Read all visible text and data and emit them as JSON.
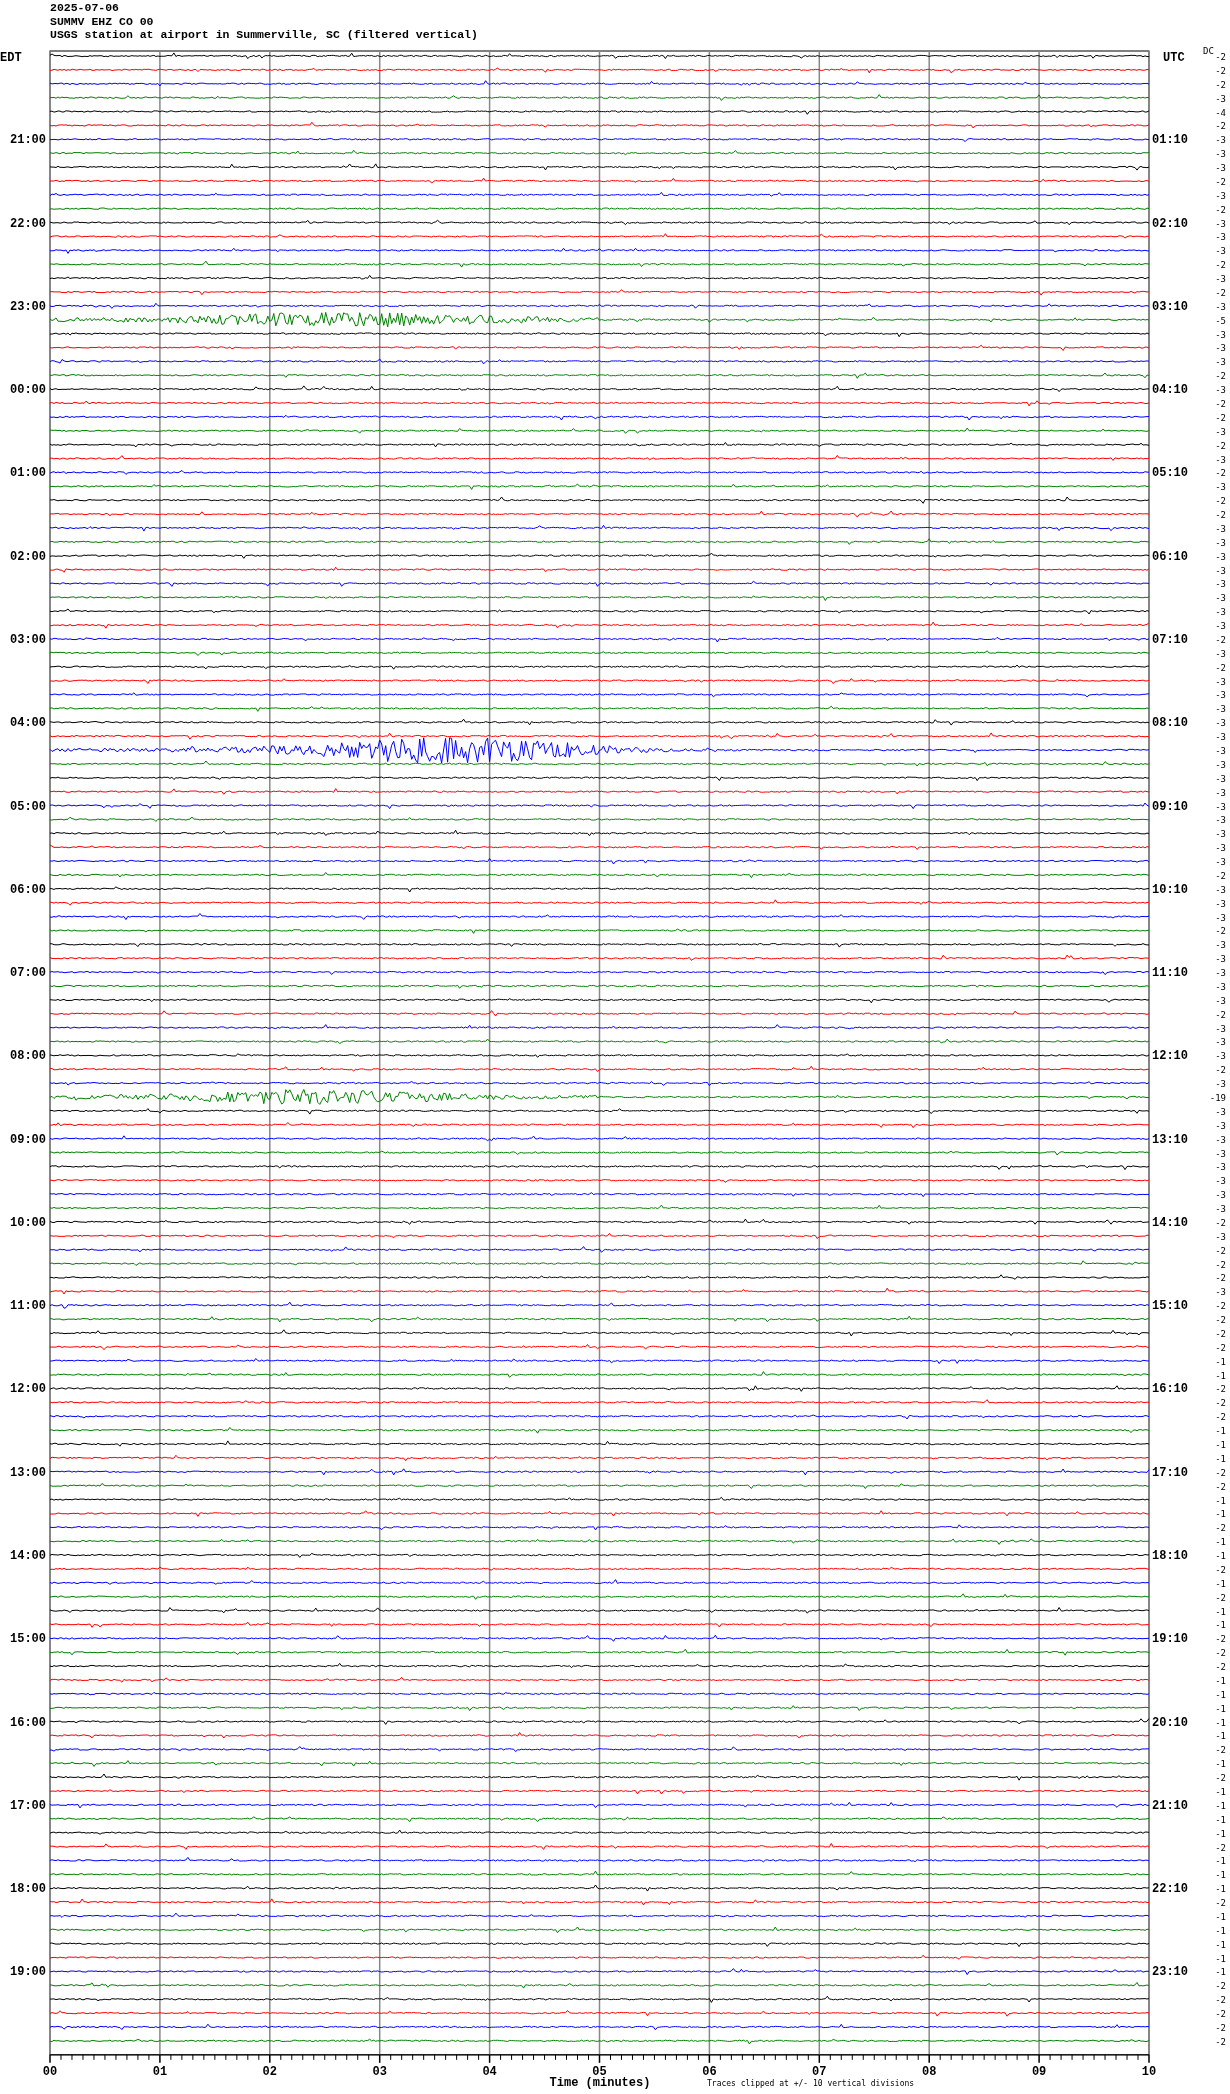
{
  "header": {
    "date": "2025-07-06",
    "station": "SUMMV EHZ CO 00",
    "description": "USGS station at airport in Summerville, SC (filtered vertical)"
  },
  "left_axis": {
    "title": "EDT",
    "labels": [
      "21:00",
      "22:00",
      "23:00",
      "00:00",
      "01:00",
      "02:00",
      "03:00",
      "04:00",
      "05:00",
      "06:00",
      "07:00",
      "08:00",
      "09:00",
      "10:00",
      "11:00",
      "12:00",
      "13:00",
      "14:00",
      "15:00",
      "16:00",
      "17:00",
      "18:00",
      "19:00"
    ]
  },
  "right_axis": {
    "title": "UTC",
    "labels": [
      "01:10",
      "02:10",
      "03:10",
      "04:10",
      "05:10",
      "06:10",
      "07:10",
      "08:10",
      "09:10",
      "10:10",
      "11:10",
      "12:10",
      "13:10",
      "14:10",
      "15:10",
      "16:10",
      "17:10",
      "18:10",
      "19:10",
      "20:10",
      "21:10",
      "22:10",
      "23:10"
    ]
  },
  "dc_title": "DC",
  "traces": [
    {
      "color": "#000000",
      "dc": "-2"
    },
    {
      "color": "#ff0000",
      "dc": "-2"
    },
    {
      "color": "#0000ff",
      "dc": "-2"
    },
    {
      "color": "#007f00",
      "dc": "-3"
    },
    {
      "color": "#000000",
      "dc": "-4"
    },
    {
      "color": "#ff0000",
      "dc": "-2"
    },
    {
      "color": "#0000ff",
      "dc": "-3"
    },
    {
      "color": "#007f00",
      "dc": "-3"
    },
    {
      "color": "#000000",
      "dc": "-3"
    },
    {
      "color": "#ff0000",
      "dc": "-2"
    },
    {
      "color": "#0000ff",
      "dc": "-3"
    },
    {
      "color": "#007f00",
      "dc": "-2"
    },
    {
      "color": "#000000",
      "dc": "-3"
    },
    {
      "color": "#ff0000",
      "dc": "-3"
    },
    {
      "color": "#0000ff",
      "dc": "-3"
    },
    {
      "color": "#007f00",
      "dc": "-2"
    },
    {
      "color": "#000000",
      "dc": "-3"
    },
    {
      "color": "#ff0000",
      "dc": "-2"
    },
    {
      "color": "#0000ff",
      "dc": "-3"
    },
    {
      "color": "#007f00",
      "dc": "-5"
    },
    {
      "color": "#000000",
      "dc": "-3"
    },
    {
      "color": "#ff0000",
      "dc": "-3"
    },
    {
      "color": "#0000ff",
      "dc": "-3"
    },
    {
      "color": "#007f00",
      "dc": "-2"
    },
    {
      "color": "#000000",
      "dc": "-3"
    },
    {
      "color": "#ff0000",
      "dc": "-2"
    },
    {
      "color": "#0000ff",
      "dc": "-2"
    },
    {
      "color": "#007f00",
      "dc": "-3"
    },
    {
      "color": "#000000",
      "dc": "-2"
    },
    {
      "color": "#ff0000",
      "dc": "-3"
    },
    {
      "color": "#0000ff",
      "dc": "-2"
    },
    {
      "color": "#007f00",
      "dc": "-3"
    },
    {
      "color": "#000000",
      "dc": "-2"
    },
    {
      "color": "#ff0000",
      "dc": "-2"
    },
    {
      "color": "#0000ff",
      "dc": "-3"
    },
    {
      "color": "#007f00",
      "dc": "-3"
    },
    {
      "color": "#000000",
      "dc": "-3"
    },
    {
      "color": "#ff0000",
      "dc": "-3"
    },
    {
      "color": "#0000ff",
      "dc": "-3"
    },
    {
      "color": "#007f00",
      "dc": "-3"
    },
    {
      "color": "#000000",
      "dc": "-3"
    },
    {
      "color": "#ff0000",
      "dc": "-3"
    },
    {
      "color": "#0000ff",
      "dc": "-2"
    },
    {
      "color": "#007f00",
      "dc": "-3"
    },
    {
      "color": "#000000",
      "dc": "-2"
    },
    {
      "color": "#ff0000",
      "dc": "-3"
    },
    {
      "color": "#0000ff",
      "dc": "-3"
    },
    {
      "color": "#007f00",
      "dc": "-3"
    },
    {
      "color": "#000000",
      "dc": "-3"
    },
    {
      "color": "#ff0000",
      "dc": "-3"
    },
    {
      "color": "#0000ff",
      "dc": "-3"
    },
    {
      "color": "#007f00",
      "dc": "-3"
    },
    {
      "color": "#000000",
      "dc": "-3"
    },
    {
      "color": "#ff0000",
      "dc": "-3"
    },
    {
      "color": "#0000ff",
      "dc": "-3"
    },
    {
      "color": "#007f00",
      "dc": "-3"
    },
    {
      "color": "#000000",
      "dc": "-3"
    },
    {
      "color": "#ff0000",
      "dc": "-3"
    },
    {
      "color": "#0000ff",
      "dc": "-3"
    },
    {
      "color": "#007f00",
      "dc": "-2"
    },
    {
      "color": "#000000",
      "dc": "-3"
    },
    {
      "color": "#ff0000",
      "dc": "-3"
    },
    {
      "color": "#0000ff",
      "dc": "-3"
    },
    {
      "color": "#007f00",
      "dc": "-2"
    },
    {
      "color": "#000000",
      "dc": "-3"
    },
    {
      "color": "#ff0000",
      "dc": "-3"
    },
    {
      "color": "#0000ff",
      "dc": "-3"
    },
    {
      "color": "#007f00",
      "dc": "-3"
    },
    {
      "color": "#000000",
      "dc": "-3"
    },
    {
      "color": "#ff0000",
      "dc": "-2"
    },
    {
      "color": "#0000ff",
      "dc": "-3"
    },
    {
      "color": "#007f00",
      "dc": "-3"
    },
    {
      "color": "#000000",
      "dc": "-3"
    },
    {
      "color": "#ff0000",
      "dc": "-2"
    },
    {
      "color": "#0000ff",
      "dc": "-3"
    },
    {
      "color": "#007f00",
      "dc": "-19"
    },
    {
      "color": "#000000",
      "dc": "-3"
    },
    {
      "color": "#ff0000",
      "dc": "-3"
    },
    {
      "color": "#0000ff",
      "dc": "-3"
    },
    {
      "color": "#007f00",
      "dc": "-3"
    },
    {
      "color": "#000000",
      "dc": "-3"
    },
    {
      "color": "#ff0000",
      "dc": "-3"
    },
    {
      "color": "#0000ff",
      "dc": "-3"
    },
    {
      "color": "#007f00",
      "dc": "-3"
    },
    {
      "color": "#000000",
      "dc": "-2"
    },
    {
      "color": "#ff0000",
      "dc": "-3"
    },
    {
      "color": "#0000ff",
      "dc": "-2"
    },
    {
      "color": "#007f00",
      "dc": "-2"
    },
    {
      "color": "#000000",
      "dc": "-2"
    },
    {
      "color": "#ff0000",
      "dc": "-3"
    },
    {
      "color": "#0000ff",
      "dc": "-2"
    },
    {
      "color": "#007f00",
      "dc": "-2"
    },
    {
      "color": "#000000",
      "dc": "-2"
    },
    {
      "color": "#ff0000",
      "dc": "-2"
    },
    {
      "color": "#0000ff",
      "dc": "-1"
    },
    {
      "color": "#007f00",
      "dc": "-1"
    },
    {
      "color": "#000000",
      "dc": "-2"
    },
    {
      "color": "#ff0000",
      "dc": "-2"
    },
    {
      "color": "#0000ff",
      "dc": "-2"
    },
    {
      "color": "#007f00",
      "dc": "-1"
    },
    {
      "color": "#000000",
      "dc": "-1"
    },
    {
      "color": "#ff0000",
      "dc": "-1"
    },
    {
      "color": "#0000ff",
      "dc": "-2"
    },
    {
      "color": "#007f00",
      "dc": "-2"
    },
    {
      "color": "#000000",
      "dc": "-1"
    },
    {
      "color": "#ff0000",
      "dc": "-1"
    },
    {
      "color": "#0000ff",
      "dc": "-2"
    },
    {
      "color": "#007f00",
      "dc": "-1"
    },
    {
      "color": "#000000",
      "dc": "-1"
    },
    {
      "color": "#ff0000",
      "dc": "-2"
    },
    {
      "color": "#0000ff",
      "dc": "-1"
    },
    {
      "color": "#007f00",
      "dc": "-2"
    },
    {
      "color": "#000000",
      "dc": "-1"
    },
    {
      "color": "#ff0000",
      "dc": "-1"
    },
    {
      "color": "#0000ff",
      "dc": "-2"
    },
    {
      "color": "#007f00",
      "dc": "-2"
    },
    {
      "color": "#000000",
      "dc": "-2"
    },
    {
      "color": "#ff0000",
      "dc": "-1"
    },
    {
      "color": "#0000ff",
      "dc": "-1"
    },
    {
      "color": "#007f00",
      "dc": "-1"
    },
    {
      "color": "#000000",
      "dc": "-1"
    },
    {
      "color": "#ff0000",
      "dc": "-1"
    },
    {
      "color": "#0000ff",
      "dc": "-2"
    },
    {
      "color": "#007f00",
      "dc": "-1"
    },
    {
      "color": "#000000",
      "dc": "-2"
    },
    {
      "color": "#ff0000",
      "dc": "-1"
    },
    {
      "color": "#0000ff",
      "dc": "-1"
    },
    {
      "color": "#007f00",
      "dc": "-1"
    },
    {
      "color": "#000000",
      "dc": "-1"
    },
    {
      "color": "#ff0000",
      "dc": "-2"
    },
    {
      "color": "#0000ff",
      "dc": "-1"
    },
    {
      "color": "#007f00",
      "dc": "-1"
    },
    {
      "color": "#000000",
      "dc": "-1"
    },
    {
      "color": "#ff0000",
      "dc": "-2"
    },
    {
      "color": "#0000ff",
      "dc": "-1"
    },
    {
      "color": "#007f00",
      "dc": "-1"
    },
    {
      "color": "#000000",
      "dc": "-1"
    },
    {
      "color": "#ff0000",
      "dc": "-1"
    },
    {
      "color": "#0000ff",
      "dc": "-1"
    },
    {
      "color": "#007f00",
      "dc": "-2"
    },
    {
      "color": "#000000",
      "dc": "-2"
    },
    {
      "color": "#ff0000",
      "dc": "-2"
    },
    {
      "color": "#0000ff",
      "dc": "-2"
    },
    {
      "color": "#007f00",
      "dc": "-2"
    }
  ],
  "x_axis": {
    "ticks": [
      "00",
      "01",
      "02",
      "03",
      "04",
      "05",
      "06",
      "07",
      "08",
      "09",
      "10"
    ],
    "label": "Time (minutes)"
  },
  "note": "Traces clipped at +/- 10 vertical divisions"
}
